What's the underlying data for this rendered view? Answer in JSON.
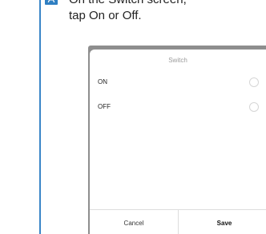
{
  "guide": {
    "step_letter": "A",
    "instruction_line1": "On the Switch screen,",
    "instruction_line2": "tap On or Off.",
    "accent_color": "#2f7fc2"
  },
  "dialog": {
    "title": "Switch",
    "options": [
      {
        "label": "ON",
        "selected": false
      },
      {
        "label": "OFF",
        "selected": false
      }
    ],
    "cancel_label": "Cancel",
    "save_label": "Save"
  }
}
